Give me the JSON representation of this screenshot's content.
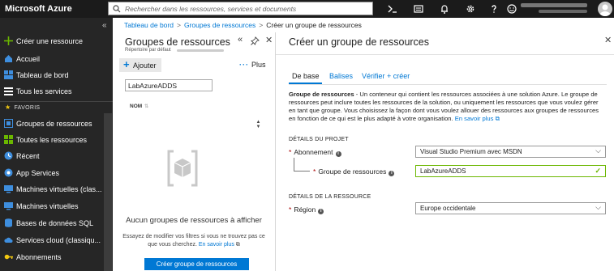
{
  "topbar": {
    "brand": "Microsoft Azure",
    "search_placeholder": "Rechercher dans les ressources, services et documents"
  },
  "sidebar": {
    "collapse": "«",
    "favorites_label": "FAVORIS",
    "items": [
      {
        "label": "Créer une ressource",
        "icon": "plus-icon"
      },
      {
        "label": "Accueil",
        "icon": "home-icon"
      },
      {
        "label": "Tableau de bord",
        "icon": "dashboard-icon"
      },
      {
        "label": "Tous les services",
        "icon": "list-icon"
      },
      {
        "label": "Groupes de ressources",
        "icon": "resource-groups-icon"
      },
      {
        "label": "Toutes les ressources",
        "icon": "all-resources-icon"
      },
      {
        "label": "Récent",
        "icon": "clock-icon"
      },
      {
        "label": "App Services",
        "icon": "app-services-icon"
      },
      {
        "label": "Machines virtuelles (clas...",
        "icon": "vm-classic-icon"
      },
      {
        "label": "Machines virtuelles",
        "icon": "vm-icon"
      },
      {
        "label": "Bases de données SQL",
        "icon": "sql-icon"
      },
      {
        "label": "Services cloud (classiqu...",
        "icon": "cloud-services-icon"
      },
      {
        "label": "Abonnements",
        "icon": "key-icon"
      }
    ]
  },
  "breadcrumb": {
    "items": [
      "Tableau de bord",
      "Groupes de ressources",
      "Créer un groupe de ressources"
    ]
  },
  "rg_blade": {
    "title": "Groupes de ressources",
    "subtitle": "Répertoire par défaut",
    "add_label": "Ajouter",
    "more_label": "Plus",
    "filter_value": "LabAzureADDS",
    "column_name": "NOM",
    "empty_title": "Aucun groupes de ressources à afficher",
    "empty_desc": "Essayez de modifier vos filtres si vous ne trouvez pas ce que vous cherchez.",
    "learn_more": "En savoir plus",
    "create_button": "Créer groupe de ressources"
  },
  "create_blade": {
    "title": "Créer un groupe de ressources",
    "tabs": [
      "De base",
      "Balises",
      "Vérifier + créer"
    ],
    "intro_bold": "Groupe de ressources",
    "intro_text": " - Un conteneur qui contient les ressources associées à une solution Azure. Le groupe de ressources peut inclure toutes les ressources de la solution, ou uniquement les ressources que vous voulez gérer en tant que groupe. Vous choisissez la façon dont vous voulez allouer des ressources aux groupes de ressources en fonction de ce qui est le plus adapté à votre organisation. ",
    "learn_more": "En savoir plus",
    "project_section": "DÉTAILS DU PROJET",
    "subscription_label": "Abonnement",
    "subscription_value": "Visual Studio Premium avec MSDN",
    "rg_label": "Groupe de ressources",
    "rg_value": "LabAzureADDS",
    "resource_section": "DÉTAILS DE LA RESSOURCE",
    "region_label": "Région",
    "region_value": "Europe occidentale"
  },
  "colors": {
    "topbar": "#1b1b1b",
    "sidebar": "#262626",
    "accent": "#0078d4",
    "valid": "#6bb700",
    "required": "#a80000"
  }
}
